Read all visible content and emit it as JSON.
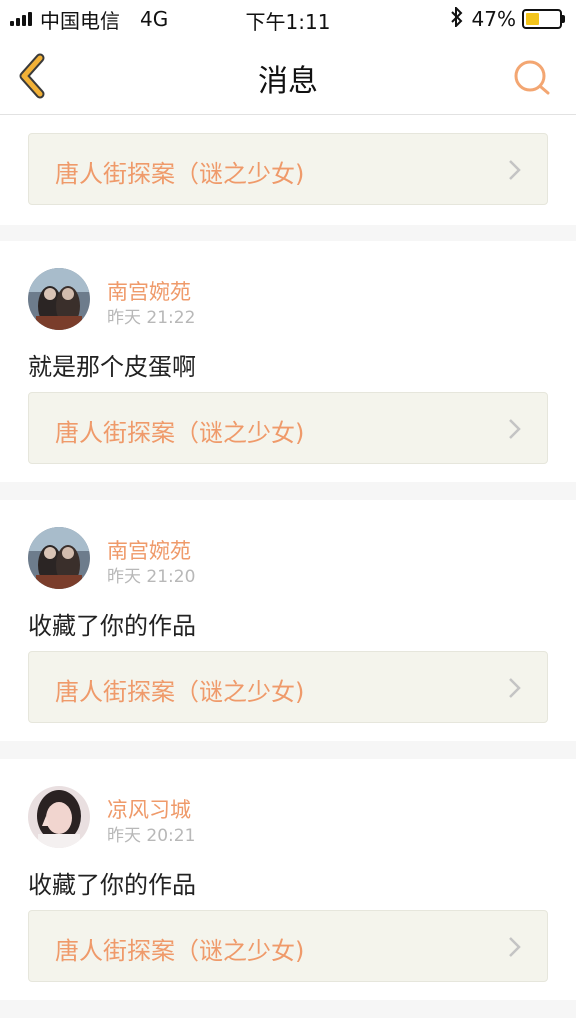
{
  "status_bar": {
    "carrier": "中国电信",
    "network": "4G",
    "time": "下午1:11",
    "battery_percent_text": "47%",
    "battery_level": 0.47,
    "battery_color": "#f3c41b"
  },
  "nav": {
    "back_icon": "chevron-left-icon",
    "title": "消息",
    "search_icon": "search-icon",
    "accent_color": "#f2b137"
  },
  "top_card": {
    "work_title": "唐人街探案（谜之少女)"
  },
  "messages": [
    {
      "user": "南宫婉苑",
      "time": "昨天 21:22",
      "text": "就是那个皮蛋啊",
      "work_title": "唐人街探案（谜之少女)"
    },
    {
      "user": "南宫婉苑",
      "time": "昨天 21:20",
      "text": "收藏了你的作品",
      "work_title": "唐人街探案（谜之少女)"
    },
    {
      "user": "凉风习城",
      "time": "昨天 20:21",
      "text": "收藏了你的作品",
      "work_title": "唐人街探案（谜之少女)"
    }
  ],
  "colors": {
    "link_text": "#ef9a6a",
    "link_bg": "#f4f4ec",
    "time_text": "#b8b8b8"
  }
}
